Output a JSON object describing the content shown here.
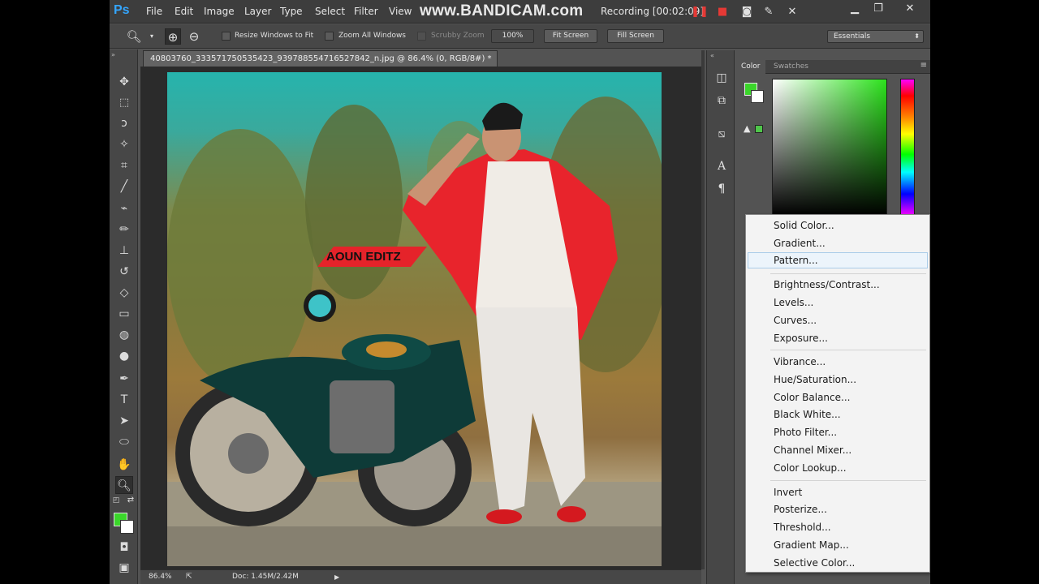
{
  "app": {
    "logo": "Ps"
  },
  "menu": [
    "File",
    "Edit",
    "Image",
    "Layer",
    "Type",
    "Select",
    "Filter",
    "View"
  ],
  "recorder": {
    "watermark": "www.BANDICAM.com",
    "status": "Recording [00:02:09]"
  },
  "options": {
    "resize_windows": "Resize Windows to Fit",
    "zoom_all": "Zoom All Windows",
    "scrubby": "Scrubby Zoom",
    "zoom_value": "100%",
    "fit_screen": "Fit Screen",
    "fill_screen": "Fill Screen",
    "workspace": "Essentials"
  },
  "document": {
    "tab_title": "40803760_333571750535423_939788554716527842_n.jpg @ 86.4% (0, RGB/8#) *",
    "canvas_text": "AOUN EDITZ"
  },
  "status": {
    "zoom": "86.4%",
    "doc": "Doc: 1.45M/2.42M"
  },
  "panels": {
    "tab_color": "Color",
    "tab_swatches": "Swatches"
  },
  "colors": {
    "foreground": "#3ad62a",
    "background": "#ffffff"
  },
  "adjustment_menu": {
    "group1": [
      "Solid Color...",
      "Gradient...",
      "Pattern..."
    ],
    "group2": [
      "Brightness/Contrast...",
      "Levels...",
      "Curves...",
      "Exposure..."
    ],
    "group3": [
      "Vibrance...",
      "Hue/Saturation...",
      "Color Balance...",
      "Black  White...",
      "Photo Filter...",
      "Channel Mixer...",
      "Color Lookup..."
    ],
    "group4": [
      "Invert",
      "Posterize...",
      "Threshold...",
      "Gradient Map...",
      "Selective Color..."
    ],
    "highlighted": "Pattern..."
  }
}
